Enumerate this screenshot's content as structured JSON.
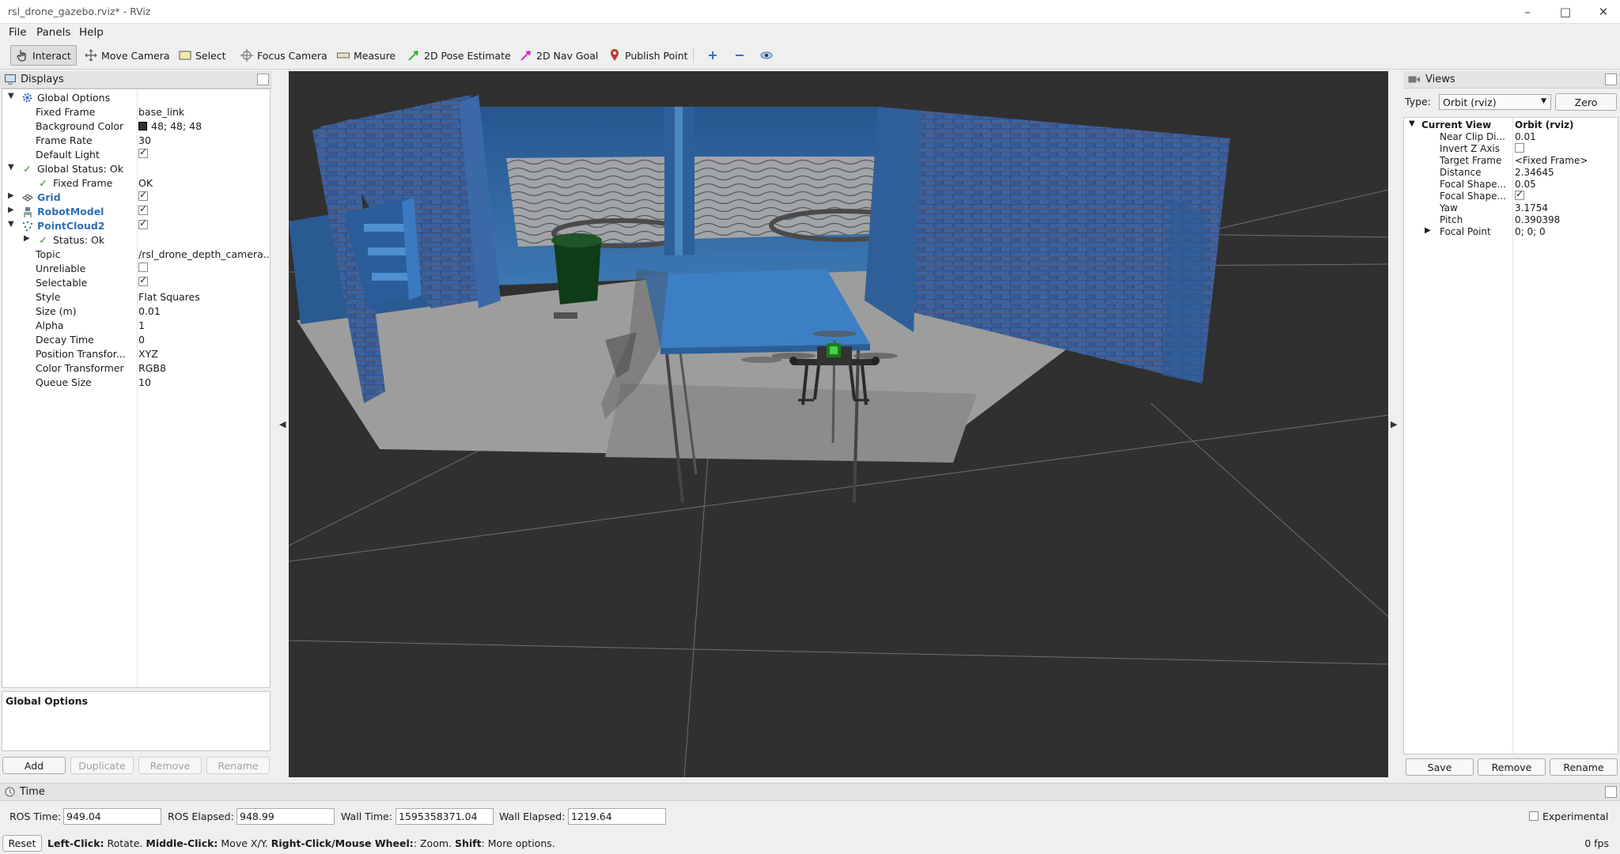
{
  "window": {
    "title": "rsl_drone_gazebo.rviz* - RViz",
    "minimize": "–",
    "maximize": "□",
    "close": "✕"
  },
  "menu": [
    "File",
    "Panels",
    "Help"
  ],
  "toolbar": {
    "tools": [
      "Interact",
      "Move Camera",
      "Select",
      "Focus Camera",
      "Measure",
      "2D Pose Estimate",
      "2D Nav Goal",
      "Publish Point"
    ],
    "active": "Interact"
  },
  "displays": {
    "title": "Displays",
    "rows": [
      {
        "name": "Global Options",
        "value": ""
      },
      {
        "name": "Fixed Frame",
        "value": "base_link"
      },
      {
        "name": "Background Color",
        "value": "48; 48; 48"
      },
      {
        "name": "Frame Rate",
        "value": "30"
      },
      {
        "name": "Default Light",
        "value": ""
      },
      {
        "name": "Global Status: Ok",
        "value": ""
      },
      {
        "name": "Fixed Frame",
        "value": "OK"
      },
      {
        "name": "Grid",
        "value": ""
      },
      {
        "name": "RobotModel",
        "value": ""
      },
      {
        "name": "PointCloud2",
        "value": ""
      },
      {
        "name": "Status: Ok",
        "value": ""
      },
      {
        "name": "Topic",
        "value": "/rsl_drone_depth_camera..."
      },
      {
        "name": "Unreliable",
        "value": ""
      },
      {
        "name": "Selectable",
        "value": ""
      },
      {
        "name": "Style",
        "value": "Flat Squares"
      },
      {
        "name": "Size (m)",
        "value": "0.01"
      },
      {
        "name": "Alpha",
        "value": "1"
      },
      {
        "name": "Decay Time",
        "value": "0"
      },
      {
        "name": "Position Transfor...",
        "value": "XYZ"
      },
      {
        "name": "Color Transformer",
        "value": "RGB8"
      },
      {
        "name": "Queue Size",
        "value": "10"
      }
    ],
    "description_title": "Global Options",
    "buttons": {
      "add": "Add",
      "duplicate": "Duplicate",
      "remove": "Remove",
      "rename": "Rename"
    }
  },
  "views": {
    "title": "Views",
    "type_label": "Type:",
    "type_value": "Orbit (rviz)",
    "zero": "Zero",
    "current_view": "Current View",
    "current_view_value": "Orbit (rviz)",
    "rows": [
      {
        "name": "Near Clip Di...",
        "value": "0.01"
      },
      {
        "name": "Invert Z Axis",
        "value": ""
      },
      {
        "name": "Target Frame",
        "value": "<Fixed Frame>"
      },
      {
        "name": "Distance",
        "value": "2.34645"
      },
      {
        "name": "Focal Shape...",
        "value": "0.05"
      },
      {
        "name": "Focal Shape...",
        "value": ""
      },
      {
        "name": "Yaw",
        "value": "3.1754"
      },
      {
        "name": "Pitch",
        "value": "0.390398"
      },
      {
        "name": "Focal Point",
        "value": "0; 0; 0"
      }
    ],
    "buttons": {
      "save": "Save",
      "remove": "Remove",
      "rename": "Rename"
    }
  },
  "time": {
    "title": "Time",
    "ros_time_label": "ROS Time:",
    "ros_time": "949.04",
    "ros_elapsed_label": "ROS Elapsed:",
    "ros_elapsed": "948.99",
    "wall_time_label": "Wall Time:",
    "wall_time": "1595358371.04",
    "wall_elapsed_label": "Wall Elapsed:",
    "wall_elapsed": "1219.64",
    "experimental": "Experimental"
  },
  "status": {
    "reset": "Reset",
    "hint_left_b": "Left-Click:",
    "hint_left": " Rotate. ",
    "hint_mid_b": "Middle-Click:",
    "hint_mid": " Move X/Y. ",
    "hint_right_b": "Right-Click/Mouse Wheel:",
    "hint_right": ": Zoom. ",
    "hint_shift_b": "Shift",
    "hint_shift": ": More options.",
    "fps": "0 fps"
  },
  "colors": {
    "viewport_bg": "#303030",
    "wall_blue": "#2e5f95",
    "floor": "#9c9c9c",
    "plugin_name": "#2f6fb6"
  }
}
